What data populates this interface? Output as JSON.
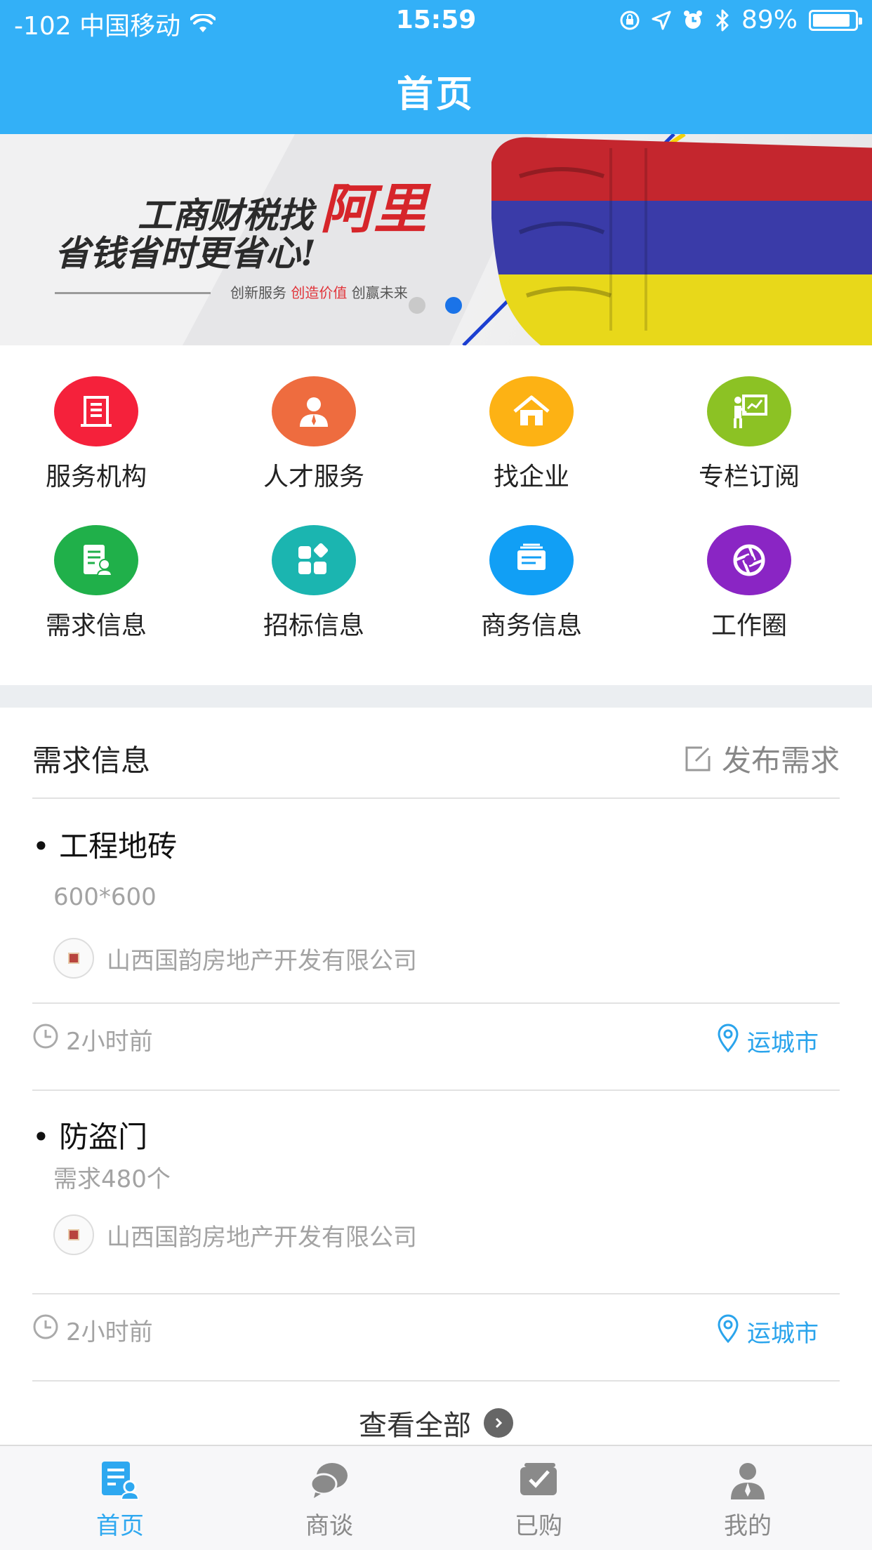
{
  "status_bar": {
    "carrier": "-102 中国移动",
    "time": "15:59",
    "battery": "89%",
    "battery_level": 0.89,
    "icons": [
      "wifi-icon",
      "orientation-lock-icon",
      "location-arrow-icon",
      "alarm-icon",
      "bluetooth-icon",
      "battery-icon"
    ]
  },
  "header": {
    "title": "首页"
  },
  "banner": {
    "line1": "工商财税找",
    "line1_accent": "阿里",
    "line2": "省钱省时更省心!",
    "tagline_a": "创新服务 ",
    "tagline_red": "创造价值",
    "tagline_b": " 创赢未来",
    "slide_count": 2,
    "active_slide": 2
  },
  "grid": [
    {
      "label": "服务机构",
      "icon": "building-icon",
      "color": "#f5213b"
    },
    {
      "label": "人才服务",
      "icon": "person-icon",
      "color": "#ee6c3f"
    },
    {
      "label": "找企业",
      "icon": "home-icon",
      "color": "#fdb214"
    },
    {
      "label": "专栏订阅",
      "icon": "presentation-icon",
      "color": "#8cc224"
    },
    {
      "label": "需求信息",
      "icon": "document-person-icon",
      "color": "#20b04a"
    },
    {
      "label": "招标信息",
      "icon": "apps-icon",
      "color": "#1bb5b0"
    },
    {
      "label": "商务信息",
      "icon": "stack-icon",
      "color": "#119ff5"
    },
    {
      "label": "工作圈",
      "icon": "aperture-icon",
      "color": "#8a25c4"
    }
  ],
  "demand": {
    "title": "需求信息",
    "publish_label": "发布需求",
    "items": [
      {
        "title": "• 工程地砖",
        "desc": "600*600",
        "company": "山西国韵房地产开发有限公司",
        "time": "2小时前",
        "location": "运城市"
      },
      {
        "title": "• 防盗门",
        "desc": "需求480个",
        "company": "山西国韵房地产开发有限公司",
        "time": "2小时前",
        "location": "运城市"
      }
    ],
    "view_all": "查看全部"
  },
  "tabbar": [
    {
      "label": "首页",
      "icon": "home-doc-icon",
      "active": true
    },
    {
      "label": "商谈",
      "icon": "chat-icon",
      "active": false
    },
    {
      "label": "已购",
      "icon": "purchased-icon",
      "active": false
    },
    {
      "label": "我的",
      "icon": "profile-icon",
      "active": false
    }
  ]
}
